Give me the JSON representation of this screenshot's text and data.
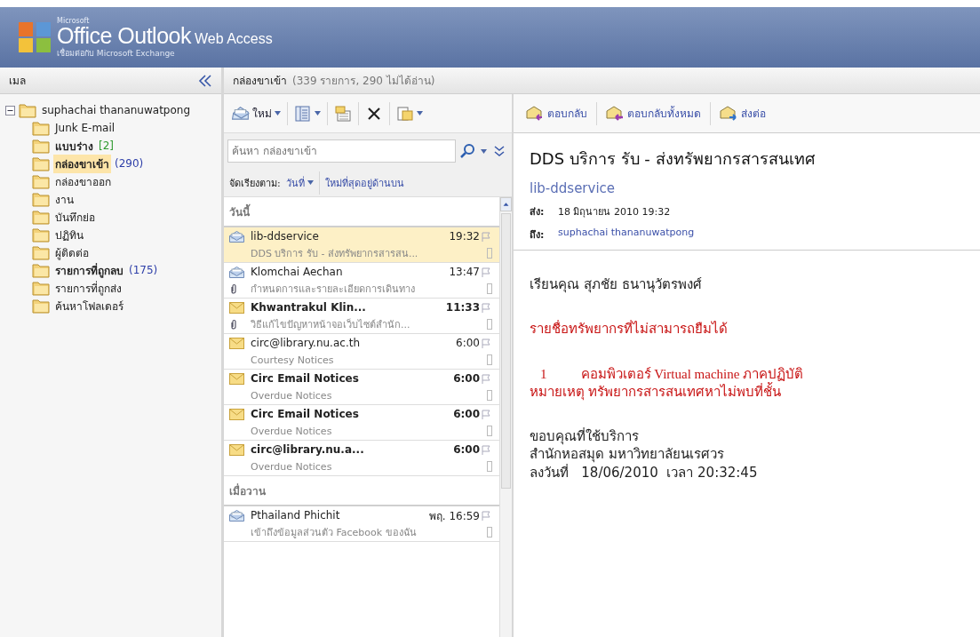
{
  "header": {
    "brand": "Microsoft",
    "product": "Office Outlook",
    "suffix": "Web Access",
    "subtitle": "เชื่อมต่อกับ Microsoft Exchange"
  },
  "nav": {
    "title": "เมล",
    "account": "suphachai thananuwatpong",
    "expanded": true,
    "folders": [
      {
        "name": "Junk E-mail",
        "unread": false,
        "selected": false
      },
      {
        "name": "แบบร่าง",
        "count": "[2]",
        "color": "#2f9a2f",
        "unread": true,
        "selected": false
      },
      {
        "name": "กล่องขาเข้า",
        "count": "(290)",
        "color": "#2d3ea8",
        "unread": true,
        "selected": true
      },
      {
        "name": "กล่องขาออก",
        "unread": false,
        "selected": false
      },
      {
        "name": "งาน",
        "unread": false,
        "selected": false
      },
      {
        "name": "บันทึกย่อ",
        "unread": false,
        "selected": false
      },
      {
        "name": "ปฏิทิน",
        "unread": false,
        "selected": false
      },
      {
        "name": "ผู้ติดต่อ",
        "unread": false,
        "selected": false
      },
      {
        "name": "รายการที่ถูกลบ",
        "count": "(175)",
        "color": "#2d3ea8",
        "unread": true,
        "selected": false
      },
      {
        "name": "รายการที่ถูกส่ง",
        "unread": false,
        "selected": false
      },
      {
        "name": "ค้นหาโฟลเดอร์",
        "unread": false,
        "selected": false
      }
    ]
  },
  "list": {
    "title": "กล่องขาเข้า",
    "summary": "(339 รายการ, 290 ไม่ได้อ่าน)",
    "new_label": "ใหม่",
    "search": {
      "placeholder": "ค้นหา กล่องขาเข้า"
    },
    "sort": {
      "label": "จัดเรียงตาม:",
      "field": "วันที่",
      "order": "ใหม่ที่สุดอยู่ด้านบน"
    },
    "groups": [
      {
        "label": "วันนี้",
        "messages": [
          {
            "sender": "lib-ddservice",
            "time": "19:32",
            "preview": "DDS บริการ รับ - ส่งทรัพยากรสารสน...",
            "opened": true,
            "unread": false,
            "attachment": false,
            "selected": true
          },
          {
            "sender": "Klomchai Aechan",
            "time": "13:47",
            "preview": "กำหนดการและรายละเอียดการเดินทาง",
            "opened": true,
            "unread": false,
            "attachment": true,
            "selected": false
          },
          {
            "sender": "Khwantrakul Klin...",
            "time": "11:33",
            "preview": "วิธีแก้ไขปัญหาหน้าจอเว็บไซต์สำนัก...",
            "opened": false,
            "unread": true,
            "attachment": true,
            "selected": false
          },
          {
            "sender": "circ@library.nu.ac.th",
            "time": "6:00",
            "preview": "Courtesy Notices",
            "opened": false,
            "unread": false,
            "attachment": false,
            "selected": false
          },
          {
            "sender": "Circ Email Notices",
            "time": "6:00",
            "preview": "Overdue Notices",
            "opened": false,
            "unread": true,
            "attachment": false,
            "selected": false
          },
          {
            "sender": "Circ Email Notices",
            "time": "6:00",
            "preview": "Overdue Notices",
            "opened": false,
            "unread": true,
            "attachment": false,
            "selected": false
          },
          {
            "sender": "circ@library.nu.a...",
            "time": "6:00",
            "preview": "Overdue Notices",
            "opened": false,
            "unread": true,
            "attachment": false,
            "selected": false
          }
        ]
      },
      {
        "label": "เมื่อวาน",
        "messages": [
          {
            "sender": "Pthailand Phichit",
            "time": "พฤ. 16:59",
            "preview": "เข้าถึงข้อมูลส่วนตัว Facebook ของฉัน",
            "opened": true,
            "unread": false,
            "attachment": false,
            "selected": false
          }
        ]
      }
    ]
  },
  "reading": {
    "actions": [
      "ตอบกลับ",
      "ตอบกลับทั้งหมด",
      "ส่งต่อ"
    ],
    "subject": "DDS บริการ รับ - ส่งทรัพยากรสารสนเทศ",
    "sender": "lib-ddservice",
    "sent_label": "ส่ง:",
    "sent": "18 มิถุนายน 2010 19:32",
    "to_label": "ถึง:",
    "to": "suphachai thananuwatpong",
    "body": [
      {
        "kind": "plain",
        "lines": [
          "เรียนคุณ สุภชัย ธนานุวัตรพงศ์"
        ]
      },
      {
        "kind": "notice",
        "lines": [
          "รายชื่อทรัพยากรที่ไม่สามารถยืมได้"
        ]
      },
      {
        "kind": "notice",
        "number": "1",
        "lines": [
          "คอมพิวเตอร์ Virtual machine ภาคปฏิบัติ",
          "หมายเหตุ ทรัพยากรสารสนเทศหาไม่พบที่ชั้น"
        ]
      },
      {
        "kind": "plain",
        "lines": [
          "ขอบคุณที่ใช้บริการ",
          "สำนักหอสมุด มหาวิทยาลัยนเรศวร",
          "ลงวันที่   18/06/2010  เวลา 20:32:45"
        ]
      }
    ]
  }
}
